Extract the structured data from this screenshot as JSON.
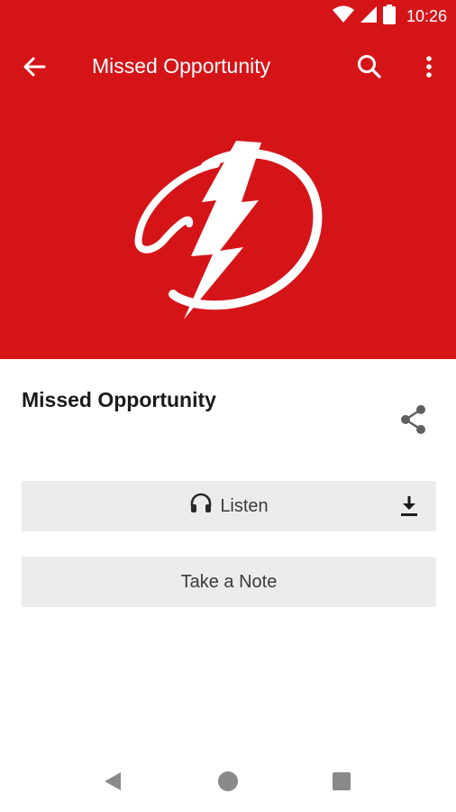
{
  "status_bar": {
    "time": "10:26",
    "icons": [
      "wifi-icon",
      "cell-signal-icon",
      "battery-icon"
    ]
  },
  "app_bar": {
    "title": "Missed Opportunity",
    "icons": [
      "arrow-back-icon",
      "search-icon",
      "more-vert-icon"
    ],
    "background": "#d51418"
  },
  "hero": {
    "logo": "lightning-d-logo"
  },
  "content": {
    "title": "Missed Opportunity",
    "share_icon": "share-icon"
  },
  "buttons": {
    "listen_label": "Listen",
    "listen_icon": "headphones-icon",
    "download_icon": "download-icon",
    "note_label": "Take a Note"
  },
  "nav_bar": {
    "icons": [
      "nav-back-icon",
      "nav-home-icon",
      "nav-recents-icon"
    ]
  }
}
